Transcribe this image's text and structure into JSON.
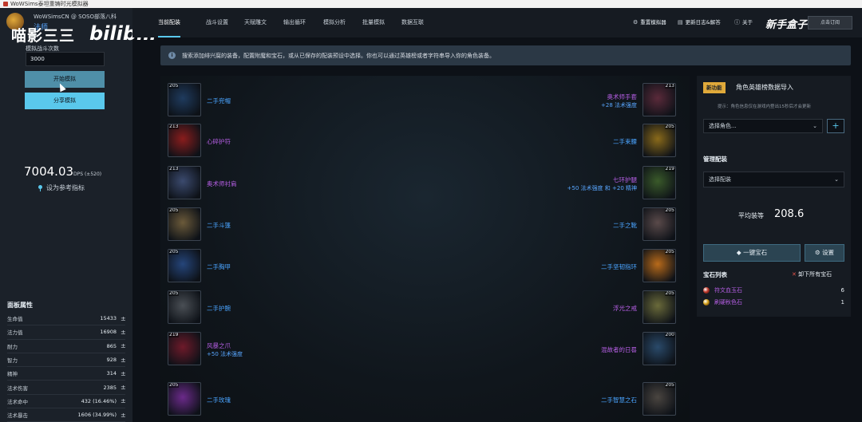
{
  "window": {
    "title": "WoWSims泰坦重铸时光模拟器"
  },
  "header": {
    "brand": "WoWSimsCN @ SOSO部落八科",
    "class_name": "法师",
    "watermark_left": "喵影三三",
    "watermark_right": "bilibili",
    "watermark_corner": "新手盒子"
  },
  "sim": {
    "iterations_label": "模拟战斗次数",
    "iterations_value": "3000",
    "start_button": "开始模拟",
    "share_button": "分享模拟"
  },
  "result": {
    "dps_value": "7004.03",
    "dps_unit": "DPS (±520)",
    "reference_label": "设为参考指标"
  },
  "stats": {
    "title": "面板属性",
    "rows": [
      {
        "name": "生命值",
        "value": "15433"
      },
      {
        "name": "法力值",
        "value": "16908"
      },
      {
        "name": "耐力",
        "value": "865"
      },
      {
        "name": "智力",
        "value": "928"
      },
      {
        "name": "精神",
        "value": "314"
      },
      {
        "name": "法术伤害",
        "value": "2385"
      },
      {
        "name": "法术命中",
        "value": "432 (16.46%)"
      },
      {
        "name": "法术暴击",
        "value": "1606 (34.99%)"
      }
    ]
  },
  "nav": {
    "tabs": [
      "当前配装",
      "战斗设置",
      "天赋雕文",
      "输出循环",
      "模拟分析",
      "批量模拟",
      "数据互联"
    ],
    "reset_label": "重置模拟器",
    "changelog_label": "更新日志&解答",
    "about_label": "关于",
    "login_label": "点击订阅"
  },
  "info_banner": "搜索添加绯兴腐的装备，配置附魔和宝石，或从已保存的配装预设中选择。你也可以通过英雄榜或者字符串导入你的角色装备。",
  "gear": {
    "left": [
      {
        "ilvl": "205",
        "name": "二手兜帽",
        "color": "blue",
        "sub": "",
        "icon_bg": "#1f3b5e"
      },
      {
        "ilvl": "213",
        "name": "心碎护符",
        "color": "purple",
        "sub": "",
        "icon_bg": "#8a1d1d"
      },
      {
        "ilvl": "213",
        "name": "奥术师衬肩",
        "color": "purple",
        "sub": "",
        "icon_bg": "#3b4a6e"
      },
      {
        "ilvl": "205",
        "name": "二手斗篷",
        "color": "blue",
        "sub": "",
        "icon_bg": "#6b5a3a"
      },
      {
        "ilvl": "205",
        "name": "二手胸甲",
        "color": "blue",
        "sub": "",
        "icon_bg": "#25457a"
      },
      {
        "ilvl": "205",
        "name": "二手护腕",
        "color": "blue",
        "sub": "",
        "icon_bg": "#4a4f55"
      },
      {
        "ilvl": "219",
        "name": "风暴之爪",
        "color": "purple",
        "sub": "+50 法术强度",
        "icon_bg": "#6e1a2a"
      },
      {
        "ilvl": "205",
        "name": "二手玫瑰",
        "color": "blue",
        "sub": "",
        "icon_bg": "#6b2a8a"
      }
    ],
    "right": [
      {
        "ilvl": "213",
        "name": "奥术师手套",
        "color": "purple",
        "sub": "+28 法术强度",
        "icon_bg": "#5a2a3a"
      },
      {
        "ilvl": "205",
        "name": "二手束腰",
        "color": "blue",
        "sub": "",
        "icon_bg": "#8a6a1a"
      },
      {
        "ilvl": "219",
        "name": "七环护腿",
        "color": "purple",
        "sub": "+50 法术强度 和 +20 精神",
        "icon_bg": "#3a5a2a"
      },
      {
        "ilvl": "205",
        "name": "二手之靴",
        "color": "blue",
        "sub": "",
        "icon_bg": "#5a4a4a"
      },
      {
        "ilvl": "205",
        "name": "二手坚韧指环",
        "color": "blue",
        "sub": "",
        "icon_bg": "#b86a1a"
      },
      {
        "ilvl": "205",
        "name": "浮光之戒",
        "color": "purple",
        "sub": "",
        "icon_bg": "#6a6a3a"
      },
      {
        "ilvl": "200",
        "name": "混故者的日晷",
        "color": "purple",
        "sub": "",
        "icon_bg": "#2a4a6a"
      },
      {
        "ilvl": "205",
        "name": "二手智慧之石",
        "color": "blue",
        "sub": "",
        "icon_bg": "#4a4540"
      }
    ]
  },
  "panel": {
    "badge": "新功能",
    "title": "角色英雄榜数据导入",
    "hint": "提示：角色信息仅在游戏内登出15秒后才会更新",
    "select_character": "选择角色...",
    "manage_title": "管理配装",
    "select_preset": "选择配装",
    "avg_label": "平均装等",
    "avg_value": "208.6",
    "gem_button": "一键宝石",
    "settings_button": "设置",
    "gems_title": "宝石列表",
    "clear_gems": "卸下所有宝石",
    "gems": [
      {
        "name": "符文血玉石",
        "count": "6",
        "color": "#c0392b"
      },
      {
        "name": "刷硬秋色石",
        "count": "1",
        "color": "#d4a017"
      }
    ]
  }
}
